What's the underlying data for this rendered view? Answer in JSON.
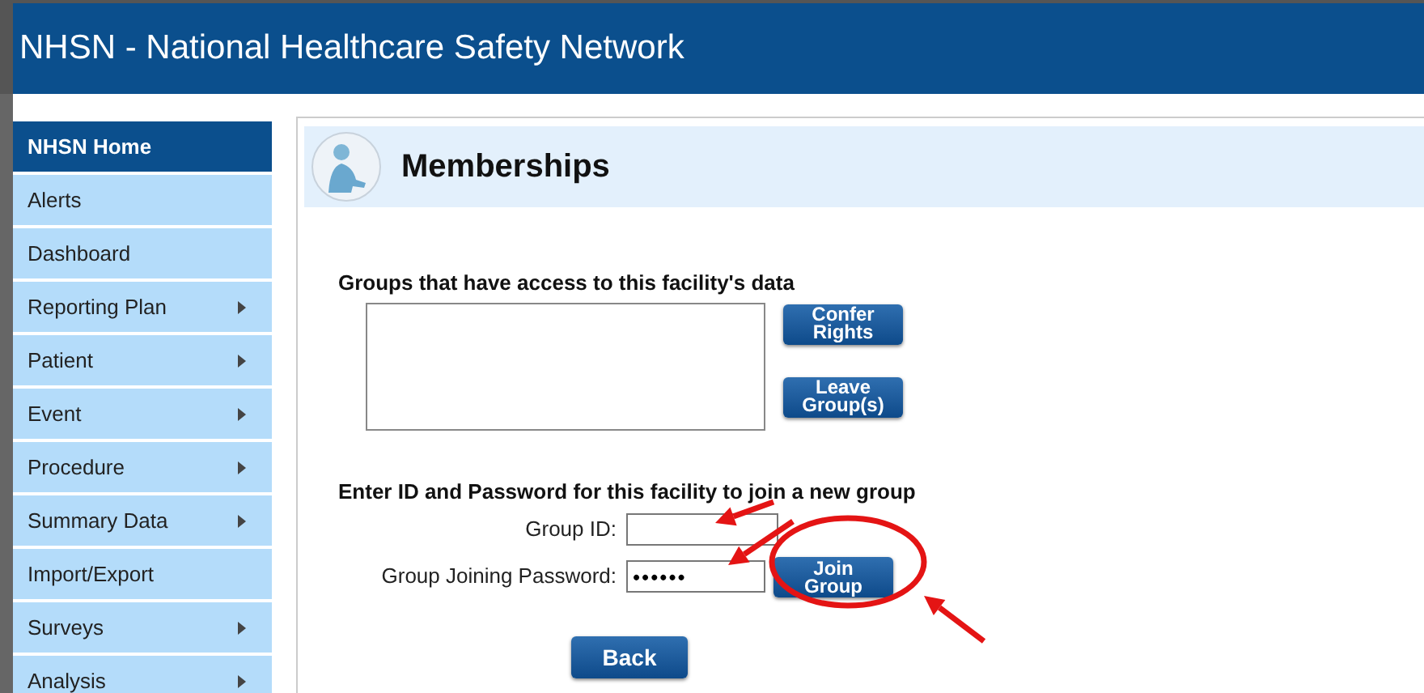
{
  "header": {
    "title": "NHSN - National Healthcare Safety Network"
  },
  "sidebar": {
    "items": [
      {
        "label": "NHSN Home",
        "selected": true,
        "has_submenu": false
      },
      {
        "label": "Alerts",
        "selected": false,
        "has_submenu": false
      },
      {
        "label": "Dashboard",
        "selected": false,
        "has_submenu": false
      },
      {
        "label": "Reporting Plan",
        "selected": false,
        "has_submenu": true
      },
      {
        "label": "Patient",
        "selected": false,
        "has_submenu": true
      },
      {
        "label": "Event",
        "selected": false,
        "has_submenu": true
      },
      {
        "label": "Procedure",
        "selected": false,
        "has_submenu": true
      },
      {
        "label": "Summary Data",
        "selected": false,
        "has_submenu": true
      },
      {
        "label": "Import/Export",
        "selected": false,
        "has_submenu": false
      },
      {
        "label": "Surveys",
        "selected": false,
        "has_submenu": true
      },
      {
        "label": "Analysis",
        "selected": false,
        "has_submenu": true
      }
    ]
  },
  "page": {
    "title": "Memberships",
    "groups_label": "Groups that have access to this facility's data",
    "group_buttons": [
      [
        "Confer",
        "Rights"
      ],
      [
        "Leave",
        "Group(s)"
      ]
    ],
    "join_label": "Enter ID and Password for this facility to join a new group",
    "fields": [
      {
        "label": "Group ID:"
      },
      {
        "label": "Group Joining Password:",
        "value": "••••••"
      }
    ],
    "join_button": [
      "Join",
      "Group"
    ],
    "back_button": "Back"
  }
}
